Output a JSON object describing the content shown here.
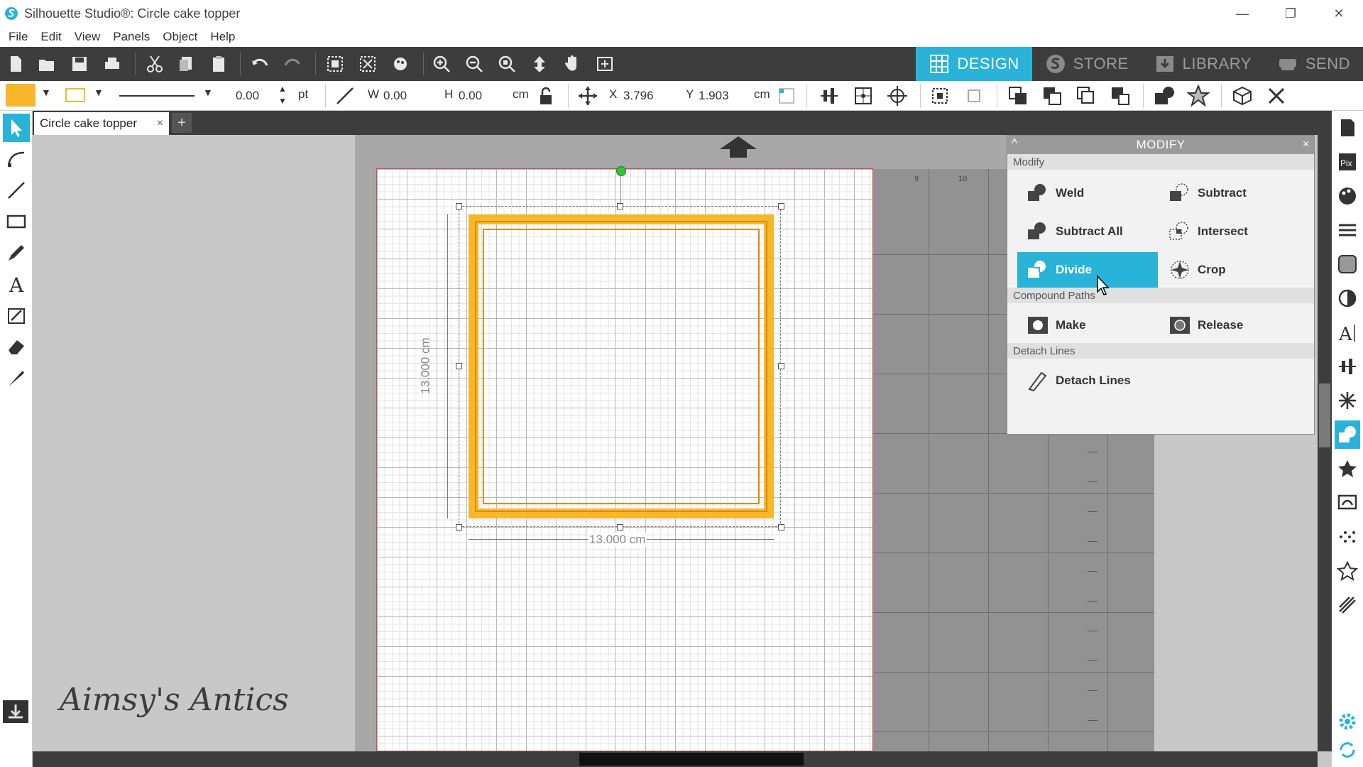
{
  "window": {
    "title": "Silhouette Studio®: Circle cake topper",
    "controls": {
      "minimize": "—",
      "restore": "❐",
      "close": "✕"
    }
  },
  "menu": [
    "File",
    "Edit",
    "View",
    "Panels",
    "Object",
    "Help"
  ],
  "main_tabs": [
    {
      "label": "DESIGN",
      "icon": "grid-icon",
      "active": true
    },
    {
      "label": "STORE",
      "icon": "store-s-icon",
      "active": false
    },
    {
      "label": "LIBRARY",
      "icon": "library-icon",
      "active": false
    },
    {
      "label": "SEND",
      "icon": "send-icon",
      "active": false
    }
  ],
  "quick_toolbar": {
    "line_width": "0.00",
    "line_unit": "pt",
    "w_label": "W",
    "w_value": "0.00",
    "h_label": "H",
    "h_value": "0.00",
    "size_unit": "cm",
    "x_label": "X",
    "x_value": "3.796",
    "y_label": "Y",
    "y_value": "1.903",
    "pos_unit": "cm",
    "fill_color": "#f7b72b"
  },
  "document_tab": {
    "label": "Circle cake topper",
    "close": "×",
    "add": "+"
  },
  "canvas": {
    "height_label": "13.000 cm",
    "width_label": "13.000 cm",
    "ruler_numbers": [
      "9",
      "10"
    ]
  },
  "modify_panel": {
    "title": "MODIFY",
    "collapse": "^",
    "close": "×",
    "sections": {
      "modify": "Modify",
      "compound": "Compound Paths",
      "detach": "Detach Lines"
    },
    "buttons": {
      "weld": "Weld",
      "subtract": "Subtract",
      "subtract_all": "Subtract All",
      "intersect": "Intersect",
      "divide": "Divide",
      "crop": "Crop",
      "make": "Make",
      "release": "Release",
      "detach_lines": "Detach Lines"
    },
    "active_button": "Divide"
  },
  "watermark": "Aimsy's Antics",
  "colors": {
    "accent": "#2ab3d9",
    "toolbar_dark": "#3d3d3d",
    "shape_fill": "#f7b72b"
  }
}
